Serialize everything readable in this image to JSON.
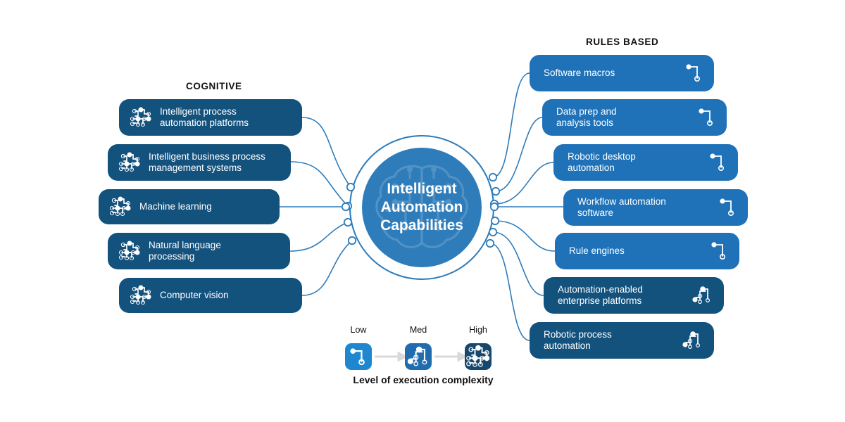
{
  "headings": {
    "cognitive": "COGNITIVE",
    "rules_based": "RULES BASED"
  },
  "hub": {
    "title": "Intelligent\nAutomation\nCapabilities",
    "circle_color": "#2E7CBA",
    "ring_color": "#2E7CBA",
    "watermark_icon": "brain-circuit-icon"
  },
  "colors": {
    "navy_box": "#14527E",
    "blue_box": "#1F72B8",
    "connector_line": "#2E7CBA",
    "legend_low": "#1F86D0",
    "legend_med": "#1F6DAF",
    "legend_high": "#16486F",
    "legend_arrow": "#D9D9D9",
    "text_light": "#FFFFFF",
    "text_dark": "#111111"
  },
  "cognitive": {
    "heading": "COGNITIVE",
    "items": [
      {
        "label": "Intelligent process\nautomation platforms",
        "complexity": "High",
        "icon": "complexity-high-icon",
        "color": "#14527E"
      },
      {
        "label": "Intelligent business process\nmanagement systems",
        "complexity": "High",
        "icon": "complexity-high-icon",
        "color": "#14527E"
      },
      {
        "label": "Machine learning",
        "complexity": "High",
        "icon": "complexity-high-icon",
        "color": "#14527E"
      },
      {
        "label": "Natural language\nprocessing",
        "complexity": "High",
        "icon": "complexity-high-icon",
        "color": "#14527E"
      },
      {
        "label": "Computer vision",
        "complexity": "High",
        "icon": "complexity-high-icon",
        "color": "#14527E"
      }
    ]
  },
  "rules_based": {
    "heading": "RULES BASED",
    "items": [
      {
        "label": "Software macros",
        "complexity": "Low",
        "icon": "complexity-low-icon",
        "color": "#1F72B8"
      },
      {
        "label": "Data prep and\nanalysis tools",
        "complexity": "Low",
        "icon": "complexity-low-icon",
        "color": "#1F72B8"
      },
      {
        "label": "Robotic desktop\nautomation",
        "complexity": "Low",
        "icon": "complexity-low-icon",
        "color": "#1F72B8"
      },
      {
        "label": "Workflow automation\nsoftware",
        "complexity": "Low",
        "icon": "complexity-low-icon",
        "color": "#1F72B8"
      },
      {
        "label": "Rule engines",
        "complexity": "Low",
        "icon": "complexity-low-icon",
        "color": "#1F72B8"
      },
      {
        "label": "Automation-enabled\nenterprise platforms",
        "complexity": "Med",
        "icon": "complexity-med-icon",
        "color": "#14527E"
      },
      {
        "label": "Robotic process\nautomation",
        "complexity": "Med",
        "icon": "complexity-med-icon",
        "color": "#14527E"
      }
    ]
  },
  "legend": {
    "caption": "Level of execution complexity",
    "steps": [
      {
        "label": "Low",
        "icon": "complexity-low-icon",
        "color": "#1F86D0"
      },
      {
        "label": "Med",
        "icon": "complexity-med-icon",
        "color": "#1F6DAF"
      },
      {
        "label": "High",
        "icon": "complexity-high-icon",
        "color": "#16486F"
      }
    ]
  }
}
